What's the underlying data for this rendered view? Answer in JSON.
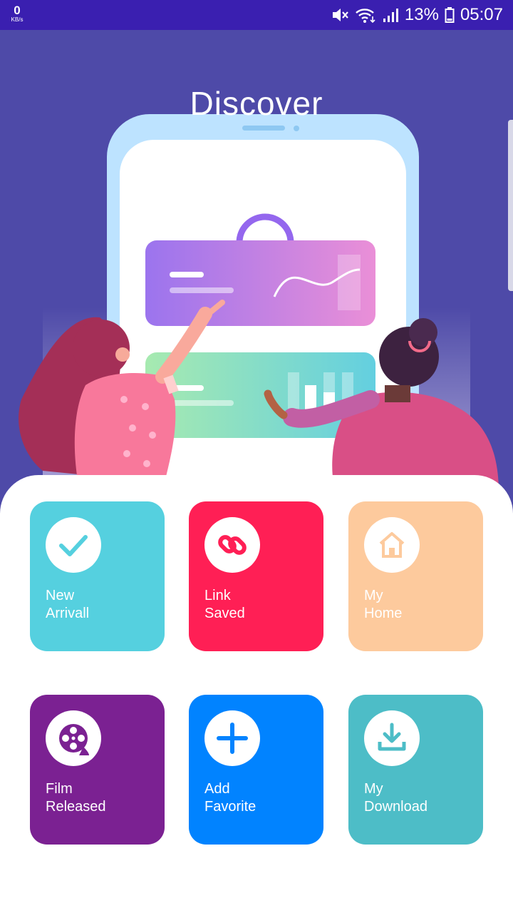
{
  "status_bar": {
    "speed_value": "0",
    "speed_unit": "KB/s",
    "battery_percent": "13%",
    "time": "05:07"
  },
  "header": {
    "title": "Discover"
  },
  "tiles": [
    {
      "line1": "New",
      "line2": "Arrivall",
      "color": "#55d0df",
      "icon": "check-icon"
    },
    {
      "line1": "Link",
      "line2": "Saved",
      "color": "#ff1f55",
      "icon": "link-icon"
    },
    {
      "line1": "My",
      "line2": "Home",
      "color": "#fdca9d",
      "icon": "home-icon"
    },
    {
      "line1": "Film",
      "line2": "Released",
      "color": "#7b2192",
      "icon": "film-reel-icon"
    },
    {
      "line1": "Add",
      "line2": "Favorite",
      "color": "#0183ff",
      "icon": "plus-icon"
    },
    {
      "line1": "My",
      "line2": "Download",
      "color": "#4dbdc7",
      "icon": "download-icon"
    }
  ]
}
